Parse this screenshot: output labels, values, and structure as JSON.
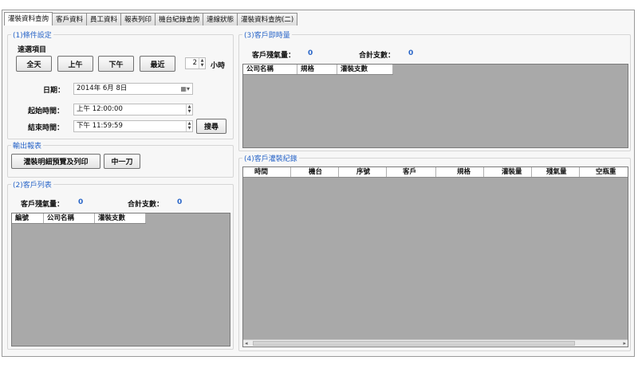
{
  "tabs": [
    "灌裝資料查詢",
    "客戶資料",
    "員工資料",
    "報表列印",
    "機台紀錄查詢",
    "連線狀態",
    "灌裝資料查詢(二)"
  ],
  "conditions": {
    "title": "(1)條件設定",
    "quick_select_label": "速選項目",
    "quick_buttons": [
      "全天",
      "上午",
      "下午",
      "最近"
    ],
    "hours_value": "2",
    "hours_unit": "小時",
    "date_label": "日期：",
    "date_value": "2014年 6月 8日",
    "start_label": "起始時間：",
    "start_value": "上午 12:00:00",
    "end_label": "結束時間：",
    "end_value": "下午 11:59:59",
    "search_button": "搜尋"
  },
  "output": {
    "title": "輸出報表",
    "print_button": "灌裝明細預覽及列印",
    "sample_button": "中一刀"
  },
  "customer_list": {
    "title": "(2)客戶列表",
    "remaining_label": "客戶殘氣量：",
    "remaining_value": "0",
    "total_label": "合計支數：",
    "total_value": "0",
    "columns": [
      "編號",
      "公司名稱",
      "灌裝支數"
    ]
  },
  "realtime": {
    "title": "(3)客戶即時量",
    "remaining_label": "客戶殘氣量：",
    "remaining_value": "0",
    "total_label": "合計支數：",
    "total_value": "0",
    "columns": [
      "公司名稱",
      "規格",
      "灌裝支數"
    ]
  },
  "records": {
    "title": "(4)客戶灌裝紀錄",
    "columns": [
      "時間",
      "機台",
      "序號",
      "客戶",
      "規格",
      "灌裝量",
      "殘氣量",
      "空瓶重"
    ]
  },
  "icons": {
    "calendar": "calendar-dropdown-icon",
    "spin": "spin-updown-icon",
    "scroll_left": "scroll-left-icon",
    "scroll_right": "scroll-right-icon"
  }
}
